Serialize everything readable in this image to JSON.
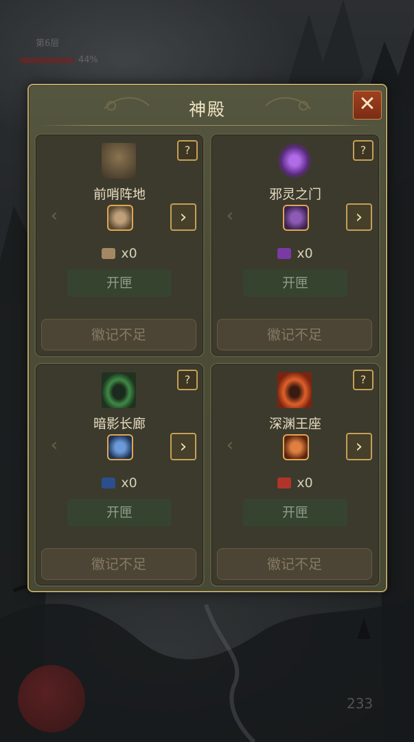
{
  "dialog": {
    "title": "神殿",
    "close_label": "✕"
  },
  "cards": [
    {
      "name": "前哨阵地",
      "count": "x0",
      "open_label": "开匣",
      "status_label": "徽记不足",
      "help": "?",
      "art_color": "#6b5a3c",
      "chest_color": "#a48863",
      "emblem_color": "#b89a6a"
    },
    {
      "name": "邪灵之门",
      "count": "x0",
      "open_label": "开匣",
      "status_label": "徽记不足",
      "help": "?",
      "art_color": "#8a3fc4",
      "chest_color": "#7a3aa5",
      "emblem_color": "#7b4aa0"
    },
    {
      "name": "暗影长廊",
      "count": "x0",
      "open_label": "开匣",
      "status_label": "徽记不足",
      "help": "?",
      "art_color": "#2f6a35",
      "chest_color": "#2b4f8c",
      "emblem_color": "#4f7ac2"
    },
    {
      "name": "深渊王座",
      "count": "x0",
      "open_label": "开匣",
      "status_label": "徽记不足",
      "help": "?",
      "art_color": "#c2441c",
      "chest_color": "#b0342a",
      "emblem_color": "#d06a28"
    }
  ],
  "arrows": {
    "left": "‹",
    "right": "›"
  },
  "background_hud": {
    "level": "第6层",
    "percent": "44%",
    "bottom_number": "233"
  }
}
